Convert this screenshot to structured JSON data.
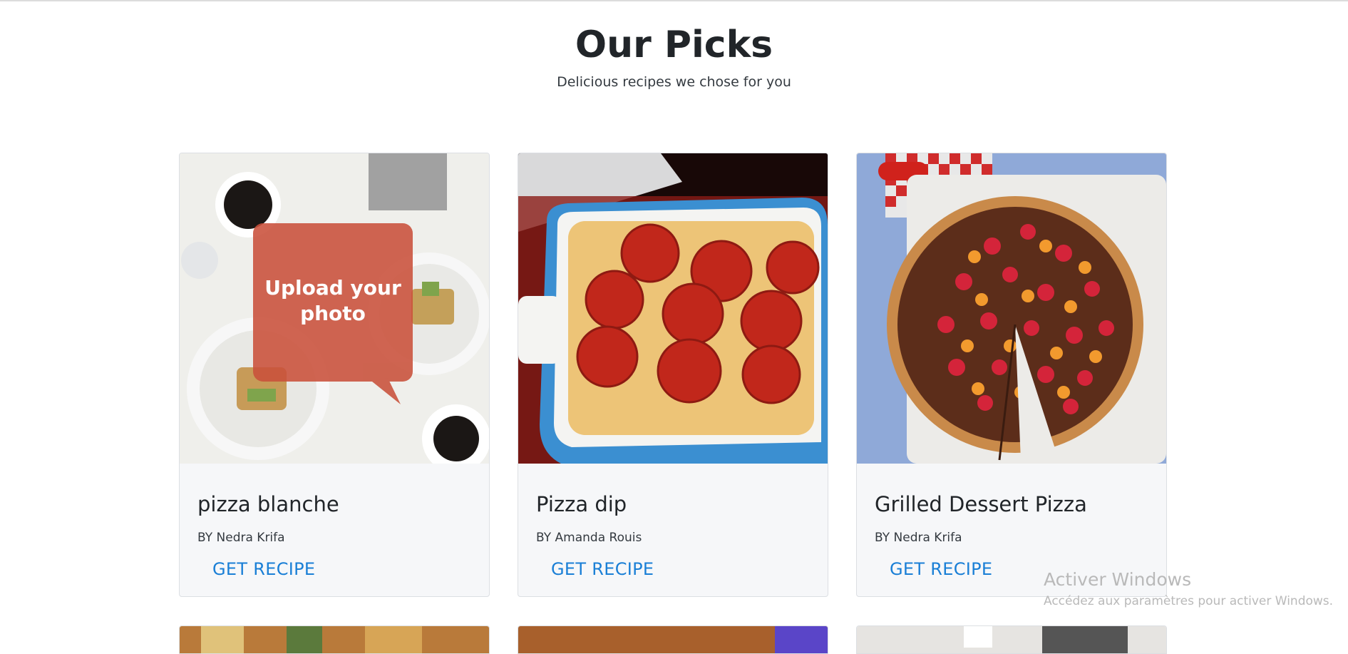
{
  "header": {
    "title": "Our Picks",
    "subtitle": "Delicious recipes we chose for you"
  },
  "cards": [
    {
      "title": "pizza blanche",
      "author": "BY Nedra Krifa",
      "link_label": "GET RECIPE",
      "image": {
        "overlay_text": "Upload your photo",
        "placeholder": true
      }
    },
    {
      "title": "Pizza dip",
      "author": "BY Amanda Rouis",
      "link_label": "GET RECIPE",
      "image": {
        "placeholder": false
      }
    },
    {
      "title": "Grilled Dessert Pizza",
      "author": "BY Nedra Krifa",
      "link_label": "GET RECIPE",
      "image": {
        "placeholder": false
      }
    }
  ],
  "watermark": {
    "title": "Activer Windows",
    "subtitle": "Accédez aux paramètres pour activer Windows."
  },
  "colors": {
    "link": "#1a7fd6",
    "card_background": "#f6f7f9",
    "card_border": "#dcdfe3",
    "upload_overlay": "#c9503a"
  }
}
